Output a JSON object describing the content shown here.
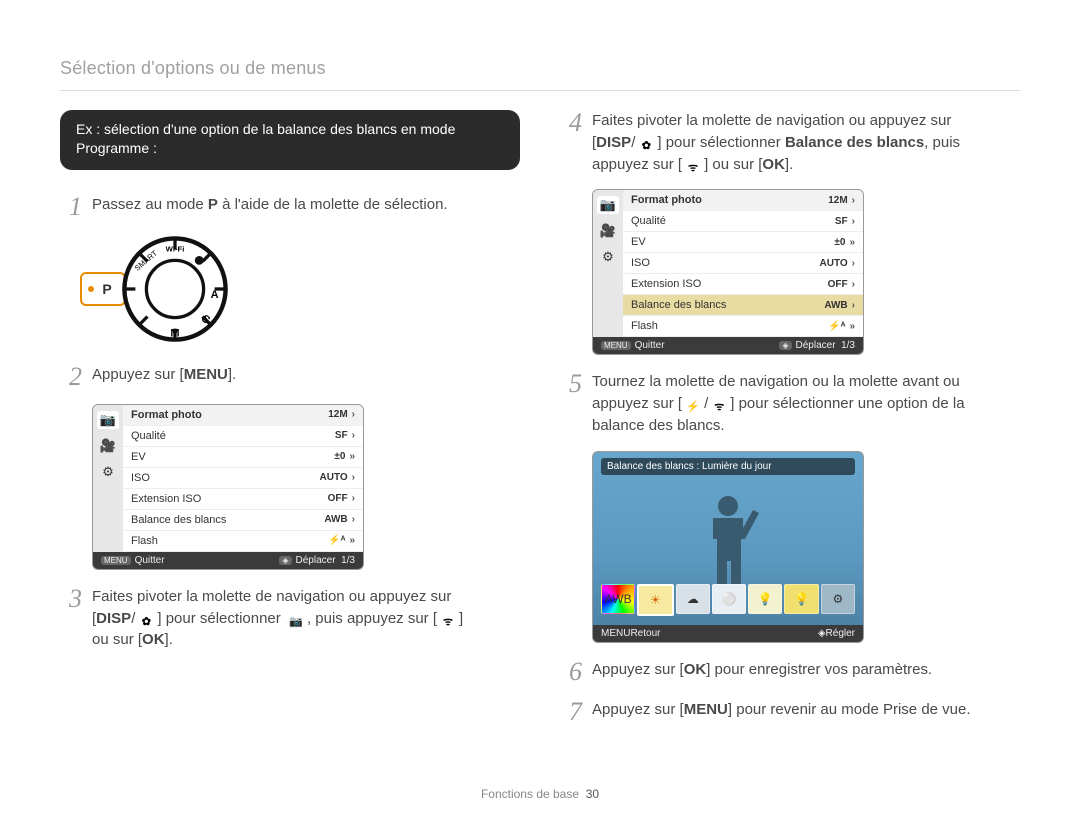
{
  "header": {
    "title": "Sélection d'options ou de menus"
  },
  "example_pill": "Ex : sélection d'une option de la balance des blancs en mode Programme :",
  "left": {
    "step1": {
      "num": "1",
      "text_pre": "Passez au mode ",
      "mode_letter": "P",
      "text_post": " à l'aide de la molette de sélection."
    },
    "dial_p_label": "P",
    "step2": {
      "num": "2",
      "text_pre": "Appuyez sur [",
      "button": "MENU",
      "text_post": "]."
    },
    "step3": {
      "num": "3",
      "line1_pre": "Faites pivoter la molette de navigation ou appuyez sur",
      "line2_pre": "[",
      "disp": "DISP",
      "slash": "/",
      "macro_icon": "✿",
      "line2_mid": "] pour sélectionner ",
      "camera_icon": "📷",
      "line2_post": ", puis appuyez sur [",
      "wifi_icon": "ᯤ",
      "line2_end": "]",
      "line3": "ou sur [",
      "ok": "OK",
      "line3_end": "]."
    }
  },
  "right": {
    "step4": {
      "num": "4",
      "line1": "Faites pivoter la molette de navigation ou appuyez sur",
      "line2_pre": "[",
      "disp": "DISP",
      "slash": "/",
      "macro_icon": "✿",
      "line2_mid": "] pour sélectionner ",
      "bold": "Balance des blancs",
      "line2_post": ", puis",
      "line3_pre": "appuyez sur [",
      "wifi_icon": "ᯤ",
      "line3_mid": "] ou sur [",
      "ok": "OK",
      "line3_end": "]."
    },
    "step5": {
      "num": "5",
      "line1": "Tournez la molette de navigation ou la molette avant ou",
      "line2_pre": "appuyez sur [",
      "flash_icon": "⚡",
      "slash": "/",
      "wifi_icon": "ᯤ",
      "line2_post": "] pour sélectionner une option de la",
      "line3": "balance des blancs."
    },
    "step6": {
      "num": "6",
      "text_pre": "Appuyez sur [",
      "ok": "OK",
      "text_post": "] pour enregistrer vos paramètres."
    },
    "step7": {
      "num": "7",
      "text_pre": "Appuyez sur [",
      "menu": "MENU",
      "text_post": "] pour revenir au mode Prise de vue."
    }
  },
  "menu1": {
    "tabs": [
      "📷",
      "🎥",
      "⚙"
    ],
    "rows": [
      {
        "label": "Format photo",
        "val": "12M",
        "chev": "›"
      },
      {
        "label": "Qualité",
        "val": "SF",
        "chev": "›"
      },
      {
        "label": "EV",
        "val": "±0",
        "chev": "»"
      },
      {
        "label": "ISO",
        "val": "AUTO",
        "chev": "›"
      },
      {
        "label": "Extension ISO",
        "val": "OFF",
        "chev": "›"
      },
      {
        "label": "Balance des blancs",
        "val": "AWB",
        "chev": "›",
        "highlight": false
      },
      {
        "label": "Flash",
        "val": "⚡ᴬ",
        "chev": "»"
      }
    ],
    "footer": {
      "left_btn": "MENU",
      "left": "Quitter",
      "right_btn": "◈",
      "right": "Déplacer",
      "page": "1/3"
    }
  },
  "menu2": {
    "tabs": [
      "📷",
      "🎥",
      "⚙"
    ],
    "rows": [
      {
        "label": "Format photo",
        "val": "12M",
        "chev": "›"
      },
      {
        "label": "Qualité",
        "val": "SF",
        "chev": "›"
      },
      {
        "label": "EV",
        "val": "±0",
        "chev": "»"
      },
      {
        "label": "ISO",
        "val": "AUTO",
        "chev": "›"
      },
      {
        "label": "Extension ISO",
        "val": "OFF",
        "chev": "›"
      },
      {
        "label": "Balance des blancs",
        "val": "AWB",
        "chev": "›",
        "highlight": true
      },
      {
        "label": "Flash",
        "val": "⚡ᴬ",
        "chev": "»"
      }
    ],
    "footer": {
      "left_btn": "MENU",
      "left": "Quitter",
      "right_btn": "◈",
      "right": "Déplacer",
      "page": "1/3"
    }
  },
  "wb": {
    "title": "Balance des blancs : Lumière du jour",
    "items": [
      "AWB",
      "☀",
      "☁",
      "⚪",
      "💡",
      "💡",
      "⚙"
    ],
    "selected_index": 1,
    "footer": {
      "left_btn": "MENU",
      "left": "Retour",
      "right_btn": "◈",
      "right": "Régler"
    }
  },
  "footer": {
    "section": "Fonctions de base",
    "page": "30"
  }
}
